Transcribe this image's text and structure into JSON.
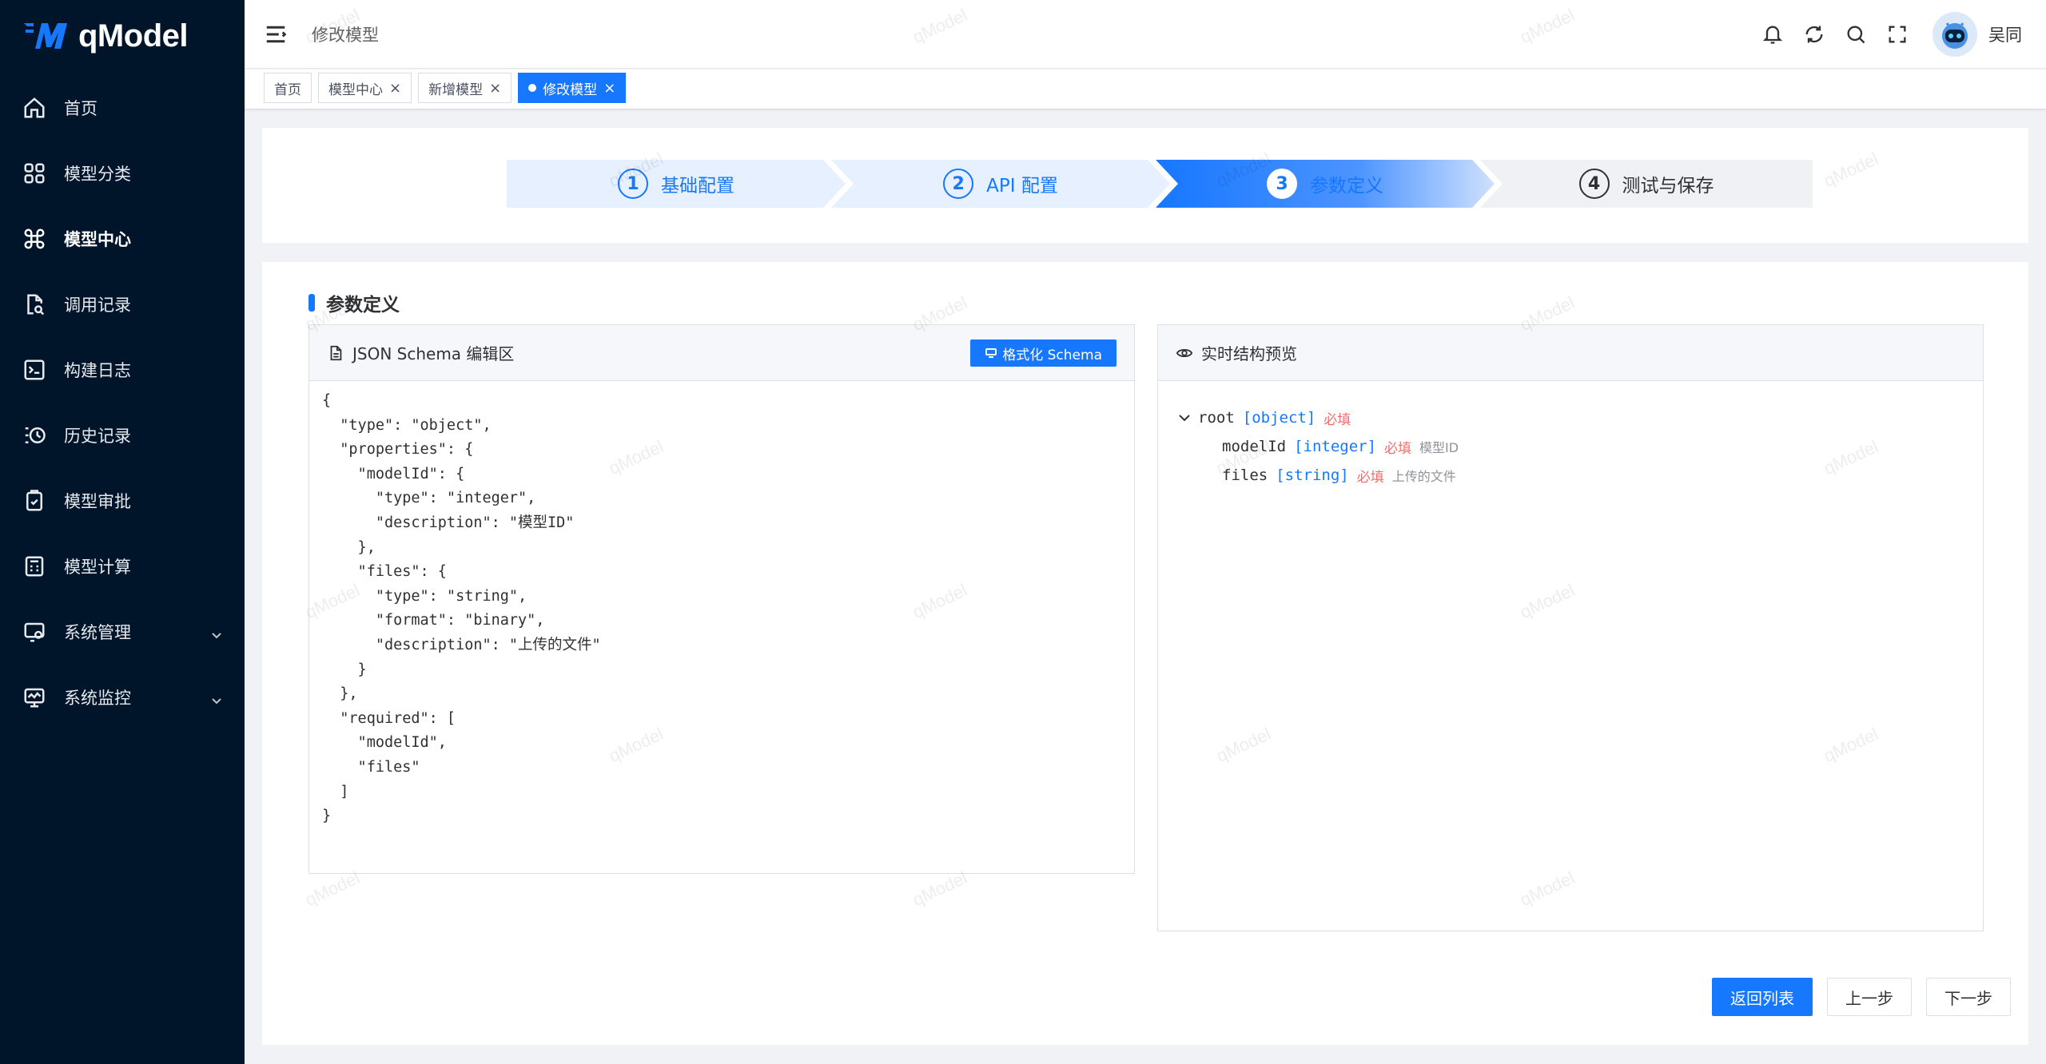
{
  "app": {
    "name": "qModel"
  },
  "sidebar": {
    "items": [
      {
        "label": "首页",
        "icon": "home-icon",
        "active": false
      },
      {
        "label": "模型分类",
        "icon": "grid-icon",
        "active": false
      },
      {
        "label": "模型中心",
        "icon": "command-icon",
        "active": true
      },
      {
        "label": "调用记录",
        "icon": "file-search-icon",
        "active": false
      },
      {
        "label": "构建日志",
        "icon": "terminal-icon",
        "active": false
      },
      {
        "label": "历史记录",
        "icon": "history-icon",
        "active": false
      },
      {
        "label": "模型审批",
        "icon": "clipboard-check-icon",
        "active": false
      },
      {
        "label": "模型计算",
        "icon": "calculator-icon",
        "active": false
      },
      {
        "label": "系统管理",
        "icon": "settings-monitor-icon",
        "active": false,
        "expandable": true
      },
      {
        "label": "系统监控",
        "icon": "monitor-chart-icon",
        "active": false,
        "expandable": true
      }
    ]
  },
  "header": {
    "breadcrumb": "修改模型",
    "icons": [
      "bell-icon",
      "refresh-icon",
      "search-icon",
      "fullscreen-icon"
    ],
    "username": "吴同"
  },
  "tabs": [
    {
      "label": "首页",
      "closable": false,
      "active": false
    },
    {
      "label": "模型中心",
      "closable": true,
      "active": false
    },
    {
      "label": "新增模型",
      "closable": true,
      "active": false
    },
    {
      "label": "修改模型",
      "closable": true,
      "active": true
    }
  ],
  "steps": [
    {
      "num": "1",
      "label": "基础配置",
      "state": "done"
    },
    {
      "num": "2",
      "label": "API 配置",
      "state": "done"
    },
    {
      "num": "3",
      "label": "参数定义",
      "state": "current"
    },
    {
      "num": "4",
      "label": "测试与保存",
      "state": "todo"
    }
  ],
  "section": {
    "title": "参数定义"
  },
  "editor_panel": {
    "title": "JSON Schema 编辑区",
    "format_button": "格式化 Schema",
    "code": "{\n  \"type\": \"object\",\n  \"properties\": {\n    \"modelId\": {\n      \"type\": \"integer\",\n      \"description\": \"模型ID\"\n    },\n    \"files\": {\n      \"type\": \"string\",\n      \"format\": \"binary\",\n      \"description\": \"上传的文件\"\n    }\n  },\n  \"required\": [\n    \"modelId\",\n    \"files\"\n  ]\n}"
  },
  "preview_panel": {
    "title": "实时结构预览",
    "root": {
      "key": "root",
      "type": "[object]",
      "required": "必填"
    },
    "children": [
      {
        "key": "modelId",
        "type": "[integer]",
        "required": "必填",
        "desc": "模型ID"
      },
      {
        "key": "files",
        "type": "[string]",
        "required": "必填",
        "desc": "上传的文件"
      }
    ]
  },
  "footer": {
    "back_label": "返回列表",
    "prev_label": "上一步",
    "next_label": "下一步"
  },
  "watermark": "qModel",
  "colors": {
    "primary": "#1677ff",
    "sidebar_bg": "#001529",
    "required": "#f56c6c"
  }
}
